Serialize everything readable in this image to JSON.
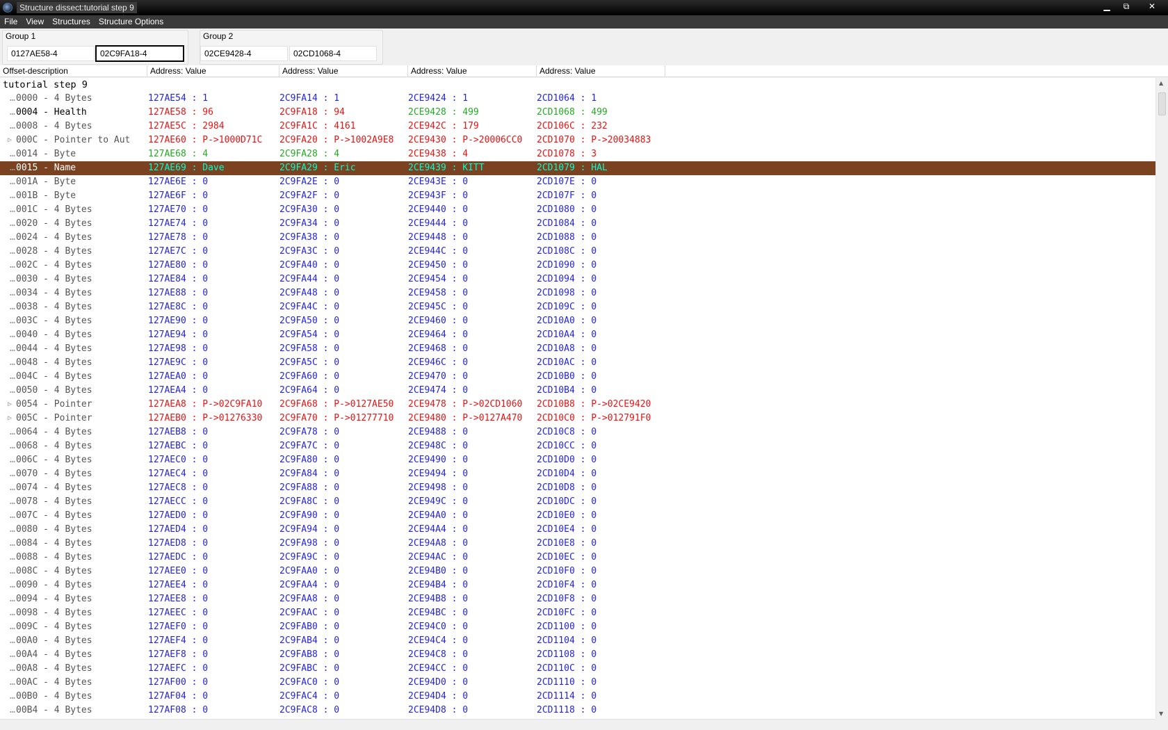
{
  "window": {
    "title": "Structure dissect:tutorial step 9"
  },
  "menu": [
    "File",
    "View",
    "Structures",
    "Structure Options"
  ],
  "groups": [
    {
      "label": "Group 1",
      "addresses": [
        "0127AE58-4",
        "02C9FA18-4"
      ]
    },
    {
      "label": "Group 2",
      "addresses": [
        "02CE9428-4",
        "02CD1068-4"
      ]
    }
  ],
  "headers": [
    "Offset-description",
    "Address: Value",
    "Address: Value",
    "Address: Value",
    "Address: Value"
  ],
  "tree_root": "tutorial step 9",
  "colors": {
    "same": "#2222ee",
    "differs": "#ee1111",
    "group_match": "#22aa22",
    "selected_bg": "#7a4220",
    "selected_text": "#00ffd0"
  },
  "rows": [
    {
      "desc": "0000 - 4 Bytes",
      "cells": [
        "127AE54 : 1",
        "2C9FA14 : 1",
        "2CE9424 : 1",
        "2CD1064 : 1"
      ],
      "colors": [
        "blue",
        "blue",
        "blue",
        "blue"
      ]
    },
    {
      "desc": "0004 - Health",
      "cells": [
        "127AE58 : 96",
        "2C9FA18 : 94",
        "2CE9428 : 499",
        "2CD1068 : 499"
      ],
      "colors": [
        "red",
        "red",
        "green",
        "green"
      ]
    },
    {
      "desc": "0008 - 4 Bytes",
      "cells": [
        "127AE5C : 2984",
        "2C9FA1C : 4161",
        "2CE942C : 179",
        "2CD106C : 232"
      ],
      "colors": [
        "red",
        "red",
        "red",
        "red"
      ]
    },
    {
      "desc": "000C - Pointer to Aut",
      "cells": [
        "127AE60 : P->1000D71C",
        "2C9FA20 : P->1002A9E8",
        "2CE9430 : P->20006CC0",
        "2CD1070 : P->20034883"
      ],
      "colors": [
        "red",
        "red",
        "red",
        "red"
      ],
      "expandable": true
    },
    {
      "desc": "0014 - Byte",
      "cells": [
        "127AE68 : 4",
        "2C9FA28 : 4",
        "2CE9438 : 4",
        "2CD1078 : 3"
      ],
      "colors": [
        "green",
        "green",
        "red",
        "red"
      ]
    },
    {
      "desc": "0015 - Name",
      "cells": [
        "127AE69 : Dave",
        "2C9FA29 : Eric",
        "2CE9439 : KITT",
        "2CD1079 : HAL"
      ],
      "colors": [
        "sel",
        "sel",
        "sel",
        "sel"
      ],
      "selected": true
    },
    {
      "desc": "001A - Byte",
      "cells": [
        "127AE6E : 0",
        "2C9FA2E : 0",
        "2CE943E : 0",
        "2CD107E : 0"
      ],
      "colors": [
        "blue",
        "blue",
        "blue",
        "blue"
      ]
    },
    {
      "desc": "001B - Byte",
      "cells": [
        "127AE6F : 0",
        "2C9FA2F : 0",
        "2CE943F : 0",
        "2CD107F : 0"
      ],
      "colors": [
        "blue",
        "blue",
        "blue",
        "blue"
      ]
    },
    {
      "desc": "001C - 4 Bytes",
      "cells": [
        "127AE70 : 0",
        "2C9FA30 : 0",
        "2CE9440 : 0",
        "2CD1080 : 0"
      ],
      "colors": [
        "blue",
        "blue",
        "blue",
        "blue"
      ]
    },
    {
      "desc": "0020 - 4 Bytes",
      "cells": [
        "127AE74 : 0",
        "2C9FA34 : 0",
        "2CE9444 : 0",
        "2CD1084 : 0"
      ],
      "colors": [
        "blue",
        "blue",
        "blue",
        "blue"
      ]
    },
    {
      "desc": "0024 - 4 Bytes",
      "cells": [
        "127AE78 : 0",
        "2C9FA38 : 0",
        "2CE9448 : 0",
        "2CD1088 : 0"
      ],
      "colors": [
        "blue",
        "blue",
        "blue",
        "blue"
      ]
    },
    {
      "desc": "0028 - 4 Bytes",
      "cells": [
        "127AE7C : 0",
        "2C9FA3C : 0",
        "2CE944C : 0",
        "2CD108C : 0"
      ],
      "colors": [
        "blue",
        "blue",
        "blue",
        "blue"
      ]
    },
    {
      "desc": "002C - 4 Bytes",
      "cells": [
        "127AE80 : 0",
        "2C9FA40 : 0",
        "2CE9450 : 0",
        "2CD1090 : 0"
      ],
      "colors": [
        "blue",
        "blue",
        "blue",
        "blue"
      ]
    },
    {
      "desc": "0030 - 4 Bytes",
      "cells": [
        "127AE84 : 0",
        "2C9FA44 : 0",
        "2CE9454 : 0",
        "2CD1094 : 0"
      ],
      "colors": [
        "blue",
        "blue",
        "blue",
        "blue"
      ]
    },
    {
      "desc": "0034 - 4 Bytes",
      "cells": [
        "127AE88 : 0",
        "2C9FA48 : 0",
        "2CE9458 : 0",
        "2CD1098 : 0"
      ],
      "colors": [
        "blue",
        "blue",
        "blue",
        "blue"
      ]
    },
    {
      "desc": "0038 - 4 Bytes",
      "cells": [
        "127AE8C : 0",
        "2C9FA4C : 0",
        "2CE945C : 0",
        "2CD109C : 0"
      ],
      "colors": [
        "blue",
        "blue",
        "blue",
        "blue"
      ]
    },
    {
      "desc": "003C - 4 Bytes",
      "cells": [
        "127AE90 : 0",
        "2C9FA50 : 0",
        "2CE9460 : 0",
        "2CD10A0 : 0"
      ],
      "colors": [
        "blue",
        "blue",
        "blue",
        "blue"
      ]
    },
    {
      "desc": "0040 - 4 Bytes",
      "cells": [
        "127AE94 : 0",
        "2C9FA54 : 0",
        "2CE9464 : 0",
        "2CD10A4 : 0"
      ],
      "colors": [
        "blue",
        "blue",
        "blue",
        "blue"
      ]
    },
    {
      "desc": "0044 - 4 Bytes",
      "cells": [
        "127AE98 : 0",
        "2C9FA58 : 0",
        "2CE9468 : 0",
        "2CD10A8 : 0"
      ],
      "colors": [
        "blue",
        "blue",
        "blue",
        "blue"
      ]
    },
    {
      "desc": "0048 - 4 Bytes",
      "cells": [
        "127AE9C : 0",
        "2C9FA5C : 0",
        "2CE946C : 0",
        "2CD10AC : 0"
      ],
      "colors": [
        "blue",
        "blue",
        "blue",
        "blue"
      ]
    },
    {
      "desc": "004C - 4 Bytes",
      "cells": [
        "127AEA0 : 0",
        "2C9FA60 : 0",
        "2CE9470 : 0",
        "2CD10B0 : 0"
      ],
      "colors": [
        "blue",
        "blue",
        "blue",
        "blue"
      ]
    },
    {
      "desc": "0050 - 4 Bytes",
      "cells": [
        "127AEA4 : 0",
        "2C9FA64 : 0",
        "2CE9474 : 0",
        "2CD10B4 : 0"
      ],
      "colors": [
        "blue",
        "blue",
        "blue",
        "blue"
      ]
    },
    {
      "desc": "0054 - Pointer",
      "cells": [
        "127AEA8 : P->02C9FA10",
        "2C9FA68 : P->0127AE50",
        "2CE9478 : P->02CD1060",
        "2CD10B8 : P->02CE9420"
      ],
      "colors": [
        "red",
        "red",
        "red",
        "red"
      ],
      "expandable": true
    },
    {
      "desc": "005C - Pointer",
      "cells": [
        "127AEB0 : P->01276330",
        "2C9FA70 : P->01277710",
        "2CE9480 : P->0127A470",
        "2CD10C0 : P->012791F0"
      ],
      "colors": [
        "red",
        "red",
        "red",
        "red"
      ],
      "expandable": true
    },
    {
      "desc": "0064 - 4 Bytes",
      "cells": [
        "127AEB8 : 0",
        "2C9FA78 : 0",
        "2CE9488 : 0",
        "2CD10C8 : 0"
      ],
      "colors": [
        "blue",
        "blue",
        "blue",
        "blue"
      ]
    },
    {
      "desc": "0068 - 4 Bytes",
      "cells": [
        "127AEBC : 0",
        "2C9FA7C : 0",
        "2CE948C : 0",
        "2CD10CC : 0"
      ],
      "colors": [
        "blue",
        "blue",
        "blue",
        "blue"
      ]
    },
    {
      "desc": "006C - 4 Bytes",
      "cells": [
        "127AEC0 : 0",
        "2C9FA80 : 0",
        "2CE9490 : 0",
        "2CD10D0 : 0"
      ],
      "colors": [
        "blue",
        "blue",
        "blue",
        "blue"
      ]
    },
    {
      "desc": "0070 - 4 Bytes",
      "cells": [
        "127AEC4 : 0",
        "2C9FA84 : 0",
        "2CE9494 : 0",
        "2CD10D4 : 0"
      ],
      "colors": [
        "blue",
        "blue",
        "blue",
        "blue"
      ]
    },
    {
      "desc": "0074 - 4 Bytes",
      "cells": [
        "127AEC8 : 0",
        "2C9FA88 : 0",
        "2CE9498 : 0",
        "2CD10D8 : 0"
      ],
      "colors": [
        "blue",
        "blue",
        "blue",
        "blue"
      ]
    },
    {
      "desc": "0078 - 4 Bytes",
      "cells": [
        "127AECC : 0",
        "2C9FA8C : 0",
        "2CE949C : 0",
        "2CD10DC : 0"
      ],
      "colors": [
        "blue",
        "blue",
        "blue",
        "blue"
      ]
    },
    {
      "desc": "007C - 4 Bytes",
      "cells": [
        "127AED0 : 0",
        "2C9FA90 : 0",
        "2CE94A0 : 0",
        "2CD10E0 : 0"
      ],
      "colors": [
        "blue",
        "blue",
        "blue",
        "blue"
      ]
    },
    {
      "desc": "0080 - 4 Bytes",
      "cells": [
        "127AED4 : 0",
        "2C9FA94 : 0",
        "2CE94A4 : 0",
        "2CD10E4 : 0"
      ],
      "colors": [
        "blue",
        "blue",
        "blue",
        "blue"
      ]
    },
    {
      "desc": "0084 - 4 Bytes",
      "cells": [
        "127AED8 : 0",
        "2C9FA98 : 0",
        "2CE94A8 : 0",
        "2CD10E8 : 0"
      ],
      "colors": [
        "blue",
        "blue",
        "blue",
        "blue"
      ]
    },
    {
      "desc": "0088 - 4 Bytes",
      "cells": [
        "127AEDC : 0",
        "2C9FA9C : 0",
        "2CE94AC : 0",
        "2CD10EC : 0"
      ],
      "colors": [
        "blue",
        "blue",
        "blue",
        "blue"
      ]
    },
    {
      "desc": "008C - 4 Bytes",
      "cells": [
        "127AEE0 : 0",
        "2C9FAA0 : 0",
        "2CE94B0 : 0",
        "2CD10F0 : 0"
      ],
      "colors": [
        "blue",
        "blue",
        "blue",
        "blue"
      ]
    },
    {
      "desc": "0090 - 4 Bytes",
      "cells": [
        "127AEE4 : 0",
        "2C9FAA4 : 0",
        "2CE94B4 : 0",
        "2CD10F4 : 0"
      ],
      "colors": [
        "blue",
        "blue",
        "blue",
        "blue"
      ]
    },
    {
      "desc": "0094 - 4 Bytes",
      "cells": [
        "127AEE8 : 0",
        "2C9FAA8 : 0",
        "2CE94B8 : 0",
        "2CD10F8 : 0"
      ],
      "colors": [
        "blue",
        "blue",
        "blue",
        "blue"
      ]
    },
    {
      "desc": "0098 - 4 Bytes",
      "cells": [
        "127AEEC : 0",
        "2C9FAAC : 0",
        "2CE94BC : 0",
        "2CD10FC : 0"
      ],
      "colors": [
        "blue",
        "blue",
        "blue",
        "blue"
      ]
    },
    {
      "desc": "009C - 4 Bytes",
      "cells": [
        "127AEF0 : 0",
        "2C9FAB0 : 0",
        "2CE94C0 : 0",
        "2CD1100 : 0"
      ],
      "colors": [
        "blue",
        "blue",
        "blue",
        "blue"
      ]
    },
    {
      "desc": "00A0 - 4 Bytes",
      "cells": [
        "127AEF4 : 0",
        "2C9FAB4 : 0",
        "2CE94C4 : 0",
        "2CD1104 : 0"
      ],
      "colors": [
        "blue",
        "blue",
        "blue",
        "blue"
      ]
    },
    {
      "desc": "00A4 - 4 Bytes",
      "cells": [
        "127AEF8 : 0",
        "2C9FAB8 : 0",
        "2CE94C8 : 0",
        "2CD1108 : 0"
      ],
      "colors": [
        "blue",
        "blue",
        "blue",
        "blue"
      ]
    },
    {
      "desc": "00A8 - 4 Bytes",
      "cells": [
        "127AEFC : 0",
        "2C9FABC : 0",
        "2CE94CC : 0",
        "2CD110C : 0"
      ],
      "colors": [
        "blue",
        "blue",
        "blue",
        "blue"
      ]
    },
    {
      "desc": "00AC - 4 Bytes",
      "cells": [
        "127AF00 : 0",
        "2C9FAC0 : 0",
        "2CE94D0 : 0",
        "2CD1110 : 0"
      ],
      "colors": [
        "blue",
        "blue",
        "blue",
        "blue"
      ]
    },
    {
      "desc": "00B0 - 4 Bytes",
      "cells": [
        "127AF04 : 0",
        "2C9FAC4 : 0",
        "2CE94D4 : 0",
        "2CD1114 : 0"
      ],
      "colors": [
        "blue",
        "blue",
        "blue",
        "blue"
      ]
    },
    {
      "desc": "00B4 - 4 Bytes",
      "cells": [
        "127AF08 : 0",
        "2C9FAC8 : 0",
        "2CE94D8 : 0",
        "2CD1118 : 0"
      ],
      "colors": [
        "blue",
        "blue",
        "blue",
        "blue"
      ]
    }
  ]
}
